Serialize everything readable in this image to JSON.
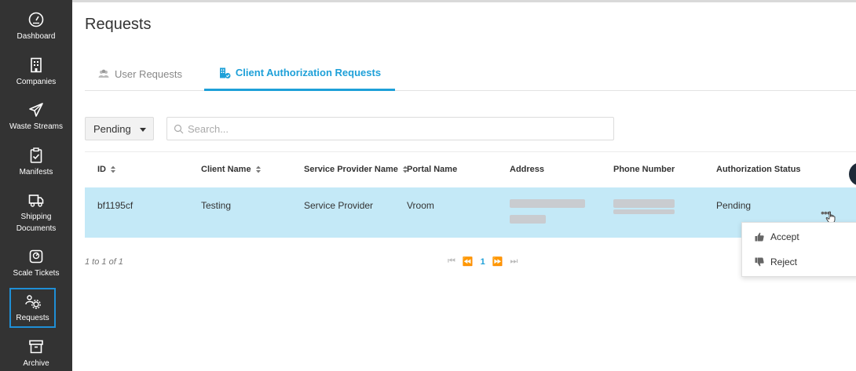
{
  "sidebar": {
    "items": [
      {
        "label": "Dashboard",
        "icon": "gauge-icon"
      },
      {
        "label": "Companies",
        "icon": "building-icon"
      },
      {
        "label": "Waste Streams",
        "icon": "paper-plane-icon"
      },
      {
        "label": "Manifests",
        "icon": "clipboard-check-icon"
      },
      {
        "label": "Shipping Documents",
        "icon": "truck-icon"
      },
      {
        "label": "Scale Tickets",
        "icon": "scale-icon"
      },
      {
        "label": "Requests",
        "icon": "users-gear-icon"
      },
      {
        "label": "Archive",
        "icon": "archive-icon"
      }
    ],
    "active": "Requests"
  },
  "page": {
    "title": "Requests"
  },
  "tabs": [
    {
      "label": "User Requests",
      "active": false
    },
    {
      "label": "Client Authorization Requests",
      "active": true
    }
  ],
  "filter": {
    "selected": "Pending"
  },
  "search": {
    "placeholder": "Search...",
    "value": ""
  },
  "table": {
    "columns": [
      "ID",
      "Client Name",
      "Service Provider Name",
      "Portal Name",
      "Address",
      "Phone Number",
      "Authorization Status"
    ],
    "rows": [
      {
        "id": "bf1195cf",
        "client_name": "Testing",
        "service_provider": "Service Provider",
        "portal_name": "Vroom",
        "address": "",
        "phone": "",
        "status": "Pending"
      }
    ]
  },
  "pagination": {
    "info": "1 to 1 of 1",
    "current_page": "1"
  },
  "row_menu": {
    "accept": "Accept",
    "reject": "Reject"
  },
  "colors": {
    "sidebar": "#333333",
    "accent": "#1ea0d8",
    "selected_row": "#c4e9f7"
  }
}
